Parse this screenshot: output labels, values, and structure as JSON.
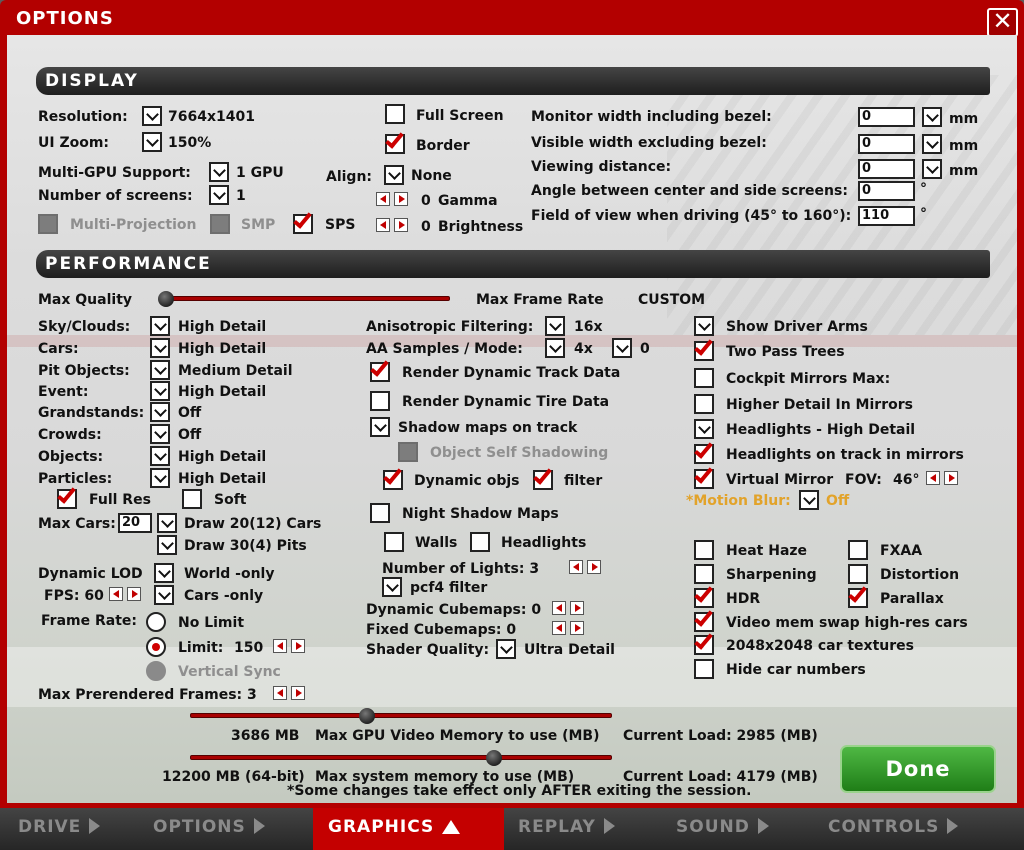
{
  "window": {
    "title": "OPTIONS",
    "close_icon": "close-icon"
  },
  "display": {
    "header": "DISPLAY",
    "resolution_label": "Resolution:",
    "resolution_value": "7664x1401",
    "ui_zoom_label": "UI Zoom:",
    "ui_zoom_value": "150%",
    "multi_gpu_label": "Multi-GPU Support:",
    "multi_gpu_value": "1 GPU",
    "num_screens_label": "Number of screens:",
    "num_screens_value": "1",
    "multi_projection_label": "Multi-Projection",
    "smp_label": "SMP",
    "sps_label": "SPS",
    "fullscreen_label": "Full Screen",
    "border_label": "Border",
    "align_label": "Align:",
    "align_value": "None",
    "gamma_value": "0",
    "gamma_label": "Gamma",
    "brightness_value": "0",
    "brightness_label": "Brightness",
    "monitor_width_label": "Monitor width including bezel:",
    "monitor_width_value": "0",
    "visible_width_label": "Visible width excluding bezel:",
    "visible_width_value": "0",
    "viewing_distance_label": "Viewing distance:",
    "viewing_distance_value": "0",
    "unit_mm": "mm",
    "angle_label": "Angle between center and side screens:",
    "angle_value": "0",
    "fov_label": "Field of view when driving (45° to 160°):",
    "fov_value": "110",
    "degree": "°"
  },
  "performance": {
    "header": "PERFORMANCE",
    "max_quality_label": "Max Quality",
    "max_frame_rate_label": "Max Frame Rate",
    "preset_value": "CUSTOM",
    "sky_label": "Sky/Clouds:",
    "sky_value": "High Detail",
    "cars_label": "Cars:",
    "cars_value": "High Detail",
    "pit_label": "Pit Objects:",
    "pit_value": "Medium Detail",
    "event_label": "Event:",
    "event_value": "High Detail",
    "grandstands_label": "Grandstands:",
    "grandstands_value": "Off",
    "crowds_label": "Crowds:",
    "crowds_value": "Off",
    "objects_label": "Objects:",
    "objects_value": "High Detail",
    "particles_label": "Particles:",
    "particles_value": "High Detail",
    "full_res_label": "Full Res",
    "soft_label": "Soft",
    "max_cars_label": "Max Cars:",
    "max_cars_value": "20",
    "draw_cars_label": "Draw 20(12) Cars",
    "draw_pits_label": "Draw 30(4) Pits",
    "dynamic_lod_label": "Dynamic LOD",
    "world_only_label": "World -only",
    "fps_label": "FPS: 60",
    "cars_only_label": "Cars -only",
    "frame_rate_label": "Frame Rate:",
    "no_limit_label": "No Limit",
    "limit_label": "Limit:",
    "limit_value": "150",
    "vsync_label": "Vertical Sync",
    "prerendered_label": "Max Prerendered Frames: 3",
    "aniso_label": "Anisotropic Filtering:",
    "aniso_value": "16x",
    "aa_label": "AA Samples / Mode:",
    "aa_value": "4x",
    "aa_mode_value": "0",
    "render_track_label": "Render Dynamic Track Data",
    "render_tire_label": "Render Dynamic Tire Data",
    "shadow_maps_label": "Shadow maps on track",
    "self_shadow_label": "Object Self Shadowing",
    "dynamic_objs_label": "Dynamic objs",
    "filter_label": "filter",
    "night_shadow_label": "Night Shadow Maps",
    "walls_label": "Walls",
    "headlights_label": "Headlights",
    "num_lights_label": "Number of Lights: 3",
    "pcf4_label": "pcf4 filter",
    "dyn_cubemaps_label": "Dynamic Cubemaps: 0",
    "fixed_cubemaps_label": "Fixed Cubemaps: 0",
    "shader_label": "Shader Quality:",
    "shader_value": "Ultra Detail",
    "driver_arms_label": "Show Driver Arms",
    "two_pass_label": "Two Pass Trees",
    "cockpit_mirrors_label": "Cockpit Mirrors  Max:",
    "higher_detail_label": "Higher Detail In Mirrors",
    "headlights_high_label": "Headlights - High Detail",
    "headlights_mirrors_label": "Headlights on track in mirrors",
    "virtual_mirror_label": "Virtual Mirror",
    "mirror_fov_label": "FOV:",
    "mirror_fov_value": "46°",
    "motion_blur_label": "*Motion Blur:",
    "motion_blur_value": "Off",
    "heat_haze_label": "Heat Haze",
    "fxaa_label": "FXAA",
    "sharpening_label": "Sharpening",
    "distortion_label": "Distortion",
    "hdr_label": "HDR",
    "parallax_label": "Parallax",
    "video_swap_label": "Video mem swap high-res cars",
    "textures_label": "2048x2048 car textures",
    "hide_numbers_label": "Hide car numbers",
    "gpu_mem_value": "3686 MB",
    "gpu_mem_label": "Max GPU Video Memory to use (MB)",
    "gpu_load": "Current Load: 2985 (MB)",
    "sys_mem_value": "12200 MB (64-bit)",
    "sys_mem_label": "Max system memory to use (MB)",
    "sys_load": "Current Load: 4179 (MB)",
    "note": "*Some changes take effect only AFTER exiting the session.",
    "max_quality_level": 0.02,
    "gpu_mem_level": 0.42,
    "sys_mem_level": 0.72
  },
  "done_label": "Done",
  "tabs": [
    {
      "label": "DRIVE"
    },
    {
      "label": "OPTIONS"
    },
    {
      "label": "GRAPHICS"
    },
    {
      "label": "REPLAY"
    },
    {
      "label": "SOUND"
    },
    {
      "label": "CONTROLS"
    }
  ],
  "colors": {
    "accent": "#b30000",
    "done": "#2e9a24",
    "motion_blur": "#e2a32a"
  }
}
